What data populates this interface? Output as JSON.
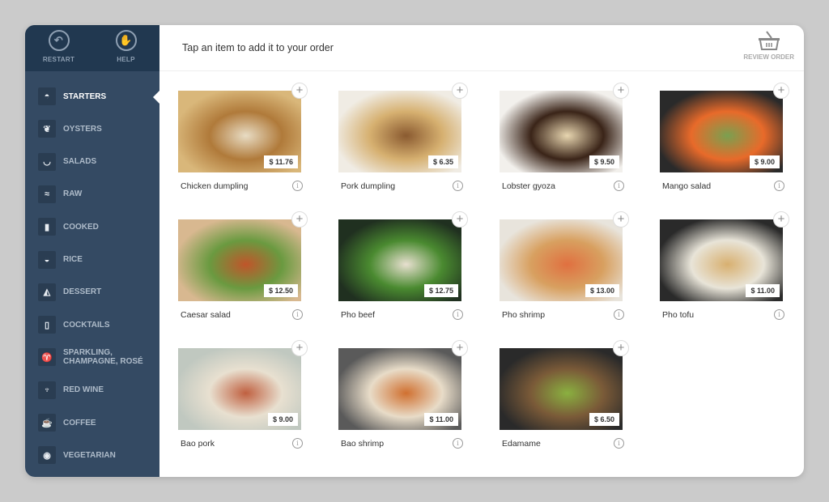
{
  "sidebar": {
    "restart": "RESTART",
    "help": "HELP",
    "items": [
      {
        "label": "STARTERS",
        "icon": "taco-icon",
        "glyph": "◓",
        "active": true
      },
      {
        "label": "OYSTERS",
        "icon": "oyster-icon",
        "glyph": "❦"
      },
      {
        "label": "SALADS",
        "icon": "salad-bowl-icon",
        "glyph": "◡"
      },
      {
        "label": "RAW",
        "icon": "fish-icon",
        "glyph": "≈"
      },
      {
        "label": "COOKED",
        "icon": "pot-icon",
        "glyph": "▮"
      },
      {
        "label": "RICE",
        "icon": "rice-bowl-icon",
        "glyph": "◒"
      },
      {
        "label": "DESSERT",
        "icon": "cake-icon",
        "glyph": "◭"
      },
      {
        "label": "COCKTAILS",
        "icon": "cocktail-icon",
        "glyph": "▯"
      },
      {
        "label": "SPARKLING, CHAMPAGNE, ROSÉ",
        "icon": "champagne-icon",
        "glyph": "♈"
      },
      {
        "label": "RED WINE",
        "icon": "wine-glass-icon",
        "glyph": "♆"
      },
      {
        "label": "COFFEE",
        "icon": "coffee-cup-icon",
        "glyph": "☕"
      },
      {
        "label": "VEGETARIAN",
        "icon": "leaf-icon",
        "glyph": "◉"
      }
    ]
  },
  "header": {
    "title": "Tap an item to add it to your order",
    "review": "REVIEW ORDER"
  },
  "items": [
    {
      "name": "Chicken dumpling",
      "price": "$ 11.76",
      "colors": [
        "#d9b77a",
        "#b07a3a",
        "#e8dcc4"
      ]
    },
    {
      "name": "Pork dumpling",
      "price": "$ 6.35",
      "colors": [
        "#f0ece4",
        "#d6b070",
        "#8a5a30"
      ]
    },
    {
      "name": "Lobster gyoza",
      "price": "$ 9.50",
      "colors": [
        "#f2f0ec",
        "#3a2418",
        "#e8d6b0"
      ]
    },
    {
      "name": "Mango salad",
      "price": "$ 9.00",
      "colors": [
        "#2a2a2a",
        "#e86a2a",
        "#7aa050"
      ]
    },
    {
      "name": "Caesar salad",
      "price": "$ 12.50",
      "colors": [
        "#d8b890",
        "#6a9a40",
        "#c0552a"
      ]
    },
    {
      "name": "Pho beef",
      "price": "$ 12.75",
      "colors": [
        "#203020",
        "#4a8a30",
        "#e8e0d0"
      ]
    },
    {
      "name": "Pho shrimp",
      "price": "$ 13.00",
      "colors": [
        "#e8e4dc",
        "#d8a060",
        "#e07040"
      ]
    },
    {
      "name": "Pho tofu",
      "price": "$ 11.00",
      "colors": [
        "#2a2a2a",
        "#e8e4d8",
        "#d8b070"
      ]
    },
    {
      "name": "Bao pork",
      "price": "$ 9.00",
      "colors": [
        "#c0c8c0",
        "#e8e0d0",
        "#c06040"
      ]
    },
    {
      "name": "Bao shrimp",
      "price": "$ 11.00",
      "colors": [
        "#5a5a5a",
        "#e8dcc8",
        "#d07030"
      ]
    },
    {
      "name": "Edamame",
      "price": "$ 6.50",
      "colors": [
        "#2a2a2a",
        "#7a5a38",
        "#8ab040"
      ]
    }
  ]
}
